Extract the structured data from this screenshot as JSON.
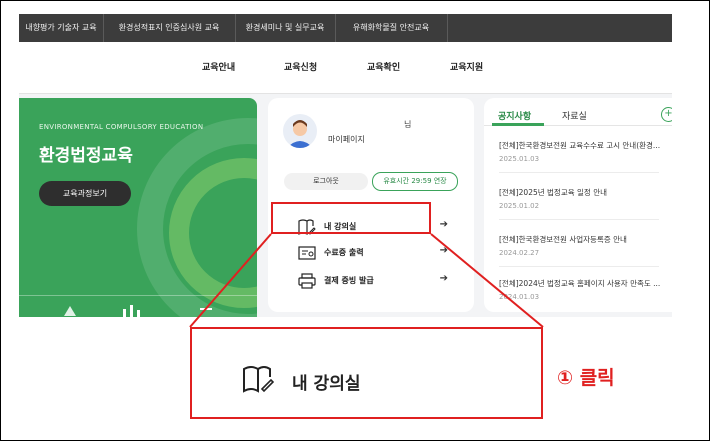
{
  "topbar": {
    "tabs": [
      "내향평가 기술자 교육",
      "환경성적표지 인증심사원 교육",
      "환경세미나 및 실무교육",
      "유해화학물질 안전교육"
    ]
  },
  "nav": {
    "items": [
      "교육안내",
      "교육신청",
      "교육확인",
      "교육지원"
    ]
  },
  "hero": {
    "eng_title": "ENVIRONMENTAL COMPULSORY EDUCATION",
    "title": "환경법정교육",
    "button": "교육과정보기"
  },
  "mypage": {
    "nim": "님",
    "label": "마이페이지",
    "logout": "로그아웃",
    "timer": "유효시간 29:59 연장",
    "menu": [
      {
        "label": "내 강의실",
        "icon": "book-pen-icon"
      },
      {
        "label": "수료증 출력",
        "icon": "certificate-icon"
      },
      {
        "label": "결제 증빙 발급",
        "icon": "printer-icon"
      }
    ],
    "arrow": "➔"
  },
  "notices": {
    "tabs": [
      "공지사항",
      "자료실"
    ],
    "plus": "+",
    "items": [
      {
        "title": "[전체]한국환경보전원 교육수수료 고시 안내(환경...",
        "date": "2025.01.03"
      },
      {
        "title": "[전체]2025년 법정교육 일정 안내",
        "date": "2025.01.02"
      },
      {
        "title": "[전체]한국환경보전원 사업자등록증 안내",
        "date": "2024.02.27"
      },
      {
        "title": "[전체]2024년 법정교육 홈페이지 사용자 만족도 ...",
        "date": "2024.01.03"
      }
    ]
  },
  "zoom": {
    "label": "내 강의실"
  },
  "callout": "① 클릭",
  "colors": {
    "accent_green": "#3aa35a",
    "highlight_red": "#e02020",
    "topbar": "#3c3c3c"
  }
}
